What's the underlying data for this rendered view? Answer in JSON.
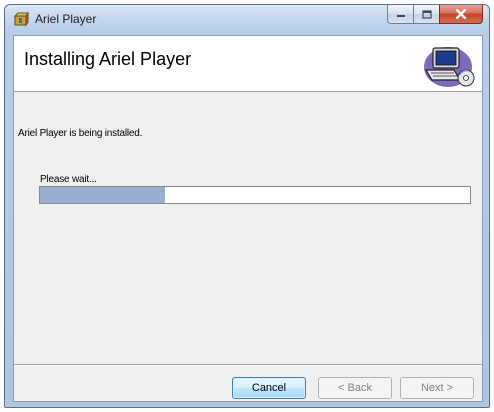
{
  "window": {
    "title": "Ariel Player",
    "minimize_icon": "minimize-icon",
    "maximize_icon": "maximize-icon",
    "close_icon": "close-icon",
    "app_icon": "installer-box-icon"
  },
  "banner": {
    "title": "Installing Ariel Player",
    "art_icon": "computer-cd-icon"
  },
  "body": {
    "status": "Ariel Player is being installed.",
    "wait_label": "Please wait..."
  },
  "progress": {
    "value": 0.29,
    "fill_color": "#98b0cf"
  },
  "buttons": {
    "cancel": "Cancel",
    "back": "< Back",
    "next": "Next >"
  },
  "colors": {
    "title_bar": "#c4d7ee",
    "close_button": "#c2432a",
    "dialog_background": "#f0f0f0",
    "focused_button_border": "#3c7fb1"
  }
}
